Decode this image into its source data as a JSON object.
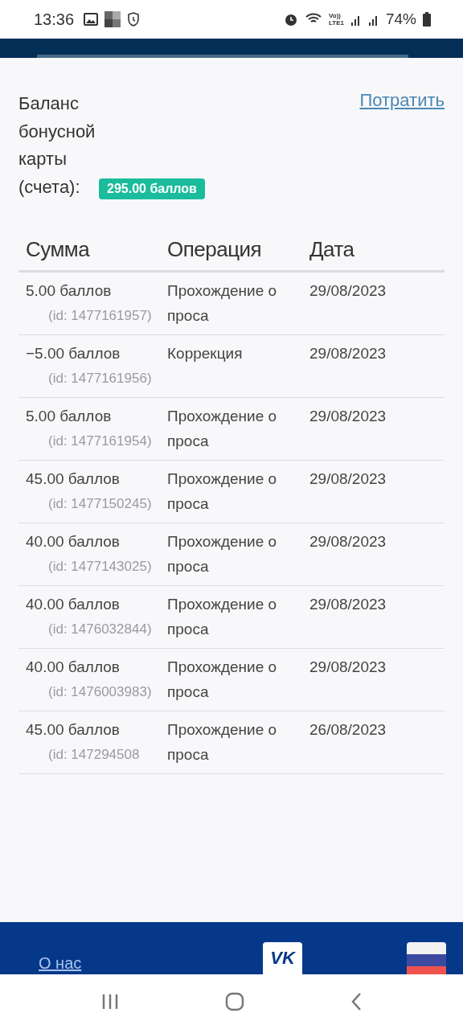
{
  "status_bar": {
    "time": "13:36",
    "volte_top": "Vo))",
    "volte_bottom": "LTE1",
    "battery": "74%"
  },
  "balance": {
    "label": "Баланс бонусной карты (счета):",
    "badge": "295.00 баллов",
    "spend_link": "Потратить"
  },
  "table": {
    "columns": [
      "Сумма",
      "Операция",
      "Дата"
    ],
    "rows": [
      {
        "amount": "5.00 баллов",
        "id": "(id: 1477161957)",
        "operation": "Прохождение опроса",
        "date": "29/08/2023"
      },
      {
        "amount": "−5.00 баллов",
        "id": "(id: 1477161956)",
        "operation": "Коррекция",
        "date": "29/08/2023"
      },
      {
        "amount": "5.00 баллов",
        "id": "(id: 1477161954)",
        "operation": "Прохождение опроса",
        "date": "29/08/2023"
      },
      {
        "amount": "45.00 баллов",
        "id": "(id: 1477150245)",
        "operation": "Прохождение опроса",
        "date": "29/08/2023"
      },
      {
        "amount": "40.00 баллов",
        "id": "(id: 1477143025)",
        "operation": "Прохождение опроса",
        "date": "29/08/2023"
      },
      {
        "amount": "40.00 баллов",
        "id": "(id: 1476032844)",
        "operation": "Прохождение опроса",
        "date": "29/08/2023"
      },
      {
        "amount": "40.00 баллов",
        "id": "(id: 1476003983)",
        "operation": "Прохождение опроса",
        "date": "29/08/2023"
      },
      {
        "amount": "45.00 баллов",
        "id": "(id: 147294508",
        "operation": "Прохождение опроса",
        "date": "26/08/2023"
      }
    ]
  },
  "footer": {
    "about_link": "О нас",
    "vk_label": "VK"
  }
}
